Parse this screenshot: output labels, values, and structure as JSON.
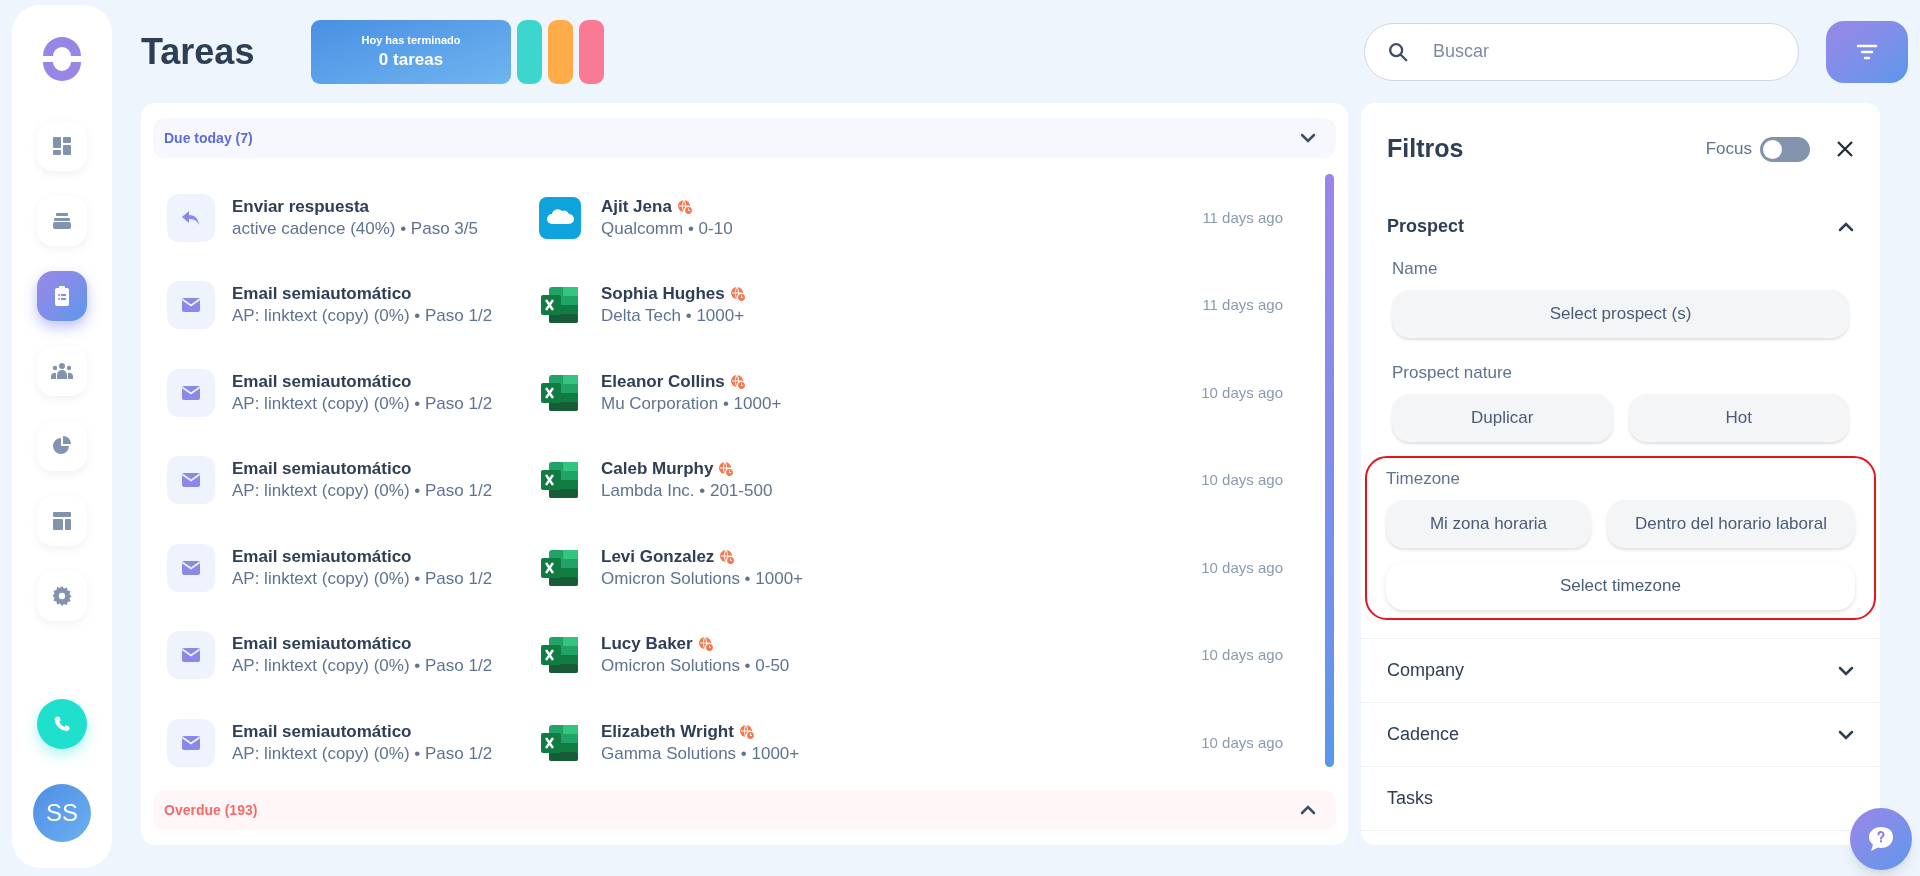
{
  "sidebar": {
    "items": [
      {
        "kind": "dashboard",
        "selected": false
      },
      {
        "kind": "inbox",
        "selected": false
      },
      {
        "kind": "tasks",
        "selected": true
      },
      {
        "kind": "people",
        "selected": false
      },
      {
        "kind": "chart",
        "selected": false
      },
      {
        "kind": "layout",
        "selected": false
      },
      {
        "kind": "settings",
        "selected": false
      }
    ],
    "avatar": "SS"
  },
  "header": {
    "title": "Tareas",
    "stats": {
      "label": "Hoy has terminado",
      "value": "0 tareas"
    },
    "pills": [
      {
        "color": "#3dd6cf"
      },
      {
        "color": "#ffab48"
      },
      {
        "color": "#fa7a93"
      }
    ],
    "search": {
      "placeholder": "Buscar"
    }
  },
  "tasks": {
    "due_today": {
      "label": "Due today (7)",
      "expanded": true
    },
    "rows": [
      {
        "kind": "reply",
        "title": "Enviar respuesta",
        "subtitle": "active cadence (40%) • Paso 3/5",
        "contact": {
          "kind": "salesforce",
          "name": "Ajit Jena",
          "company": "Qualcomm • 0-10"
        },
        "time": "11 days ago"
      },
      {
        "kind": "email",
        "title": "Email semiautomático",
        "subtitle": "AP: linktext (copy) (0%) • Paso 1/2",
        "contact": {
          "kind": "excel",
          "name": "Sophia Hughes",
          "company": "Delta Tech • 1000+"
        },
        "time": "11 days ago"
      },
      {
        "kind": "email",
        "title": "Email semiautomático",
        "subtitle": "AP: linktext (copy) (0%) • Paso 1/2",
        "contact": {
          "kind": "excel",
          "name": "Eleanor Collins",
          "company": "Mu Corporation • 1000+"
        },
        "time": "10 days ago"
      },
      {
        "kind": "email",
        "title": "Email semiautomático",
        "subtitle": "AP: linktext (copy) (0%) • Paso 1/2",
        "contact": {
          "kind": "excel",
          "name": "Caleb Murphy",
          "company": "Lambda Inc. • 201-500"
        },
        "time": "10 days ago"
      },
      {
        "kind": "email",
        "title": "Email semiautomático",
        "subtitle": "AP: linktext (copy) (0%) • Paso 1/2",
        "contact": {
          "kind": "excel",
          "name": "Levi Gonzalez",
          "company": "Omicron Solutions • 1000+"
        },
        "time": "10 days ago"
      },
      {
        "kind": "email",
        "title": "Email semiautomático",
        "subtitle": "AP: linktext (copy) (0%) • Paso 1/2",
        "contact": {
          "kind": "excel",
          "name": "Lucy Baker",
          "company": "Omicron Solutions • 0-50"
        },
        "time": "10 days ago"
      },
      {
        "kind": "email",
        "title": "Email semiautomático",
        "subtitle": "AP: linktext (copy) (0%) • Paso 1/2",
        "contact": {
          "kind": "excel",
          "name": "Elizabeth Wright",
          "company": "Gamma Solutions • 1000+"
        },
        "time": "10 days ago"
      }
    ],
    "overdue": {
      "label": "Overdue (193)",
      "expanded": false
    }
  },
  "filters": {
    "title": "Filtros",
    "focus": {
      "label": "Focus",
      "on": false
    },
    "sections": [
      {
        "title": "Prospect",
        "expanded": true,
        "groups": [
          {
            "label": "Name",
            "highlighted": false,
            "options": [
              {
                "label": "Select prospect (s)",
                "kind": "filled"
              }
            ]
          },
          {
            "label": "Prospect nature",
            "highlighted": false,
            "options": [
              {
                "label": "Duplicar",
                "kind": "filled"
              },
              {
                "label": "Hot",
                "kind": "filled"
              }
            ]
          },
          {
            "label": "Timezone",
            "highlighted": true,
            "options": [
              {
                "label": "Mi zona horaria",
                "kind": "filled"
              },
              {
                "label": "Dentro del horario laboral",
                "kind": "filled"
              },
              {
                "label": "Select timezone",
                "kind": "outline"
              }
            ]
          }
        ]
      },
      {
        "title": "Company",
        "expanded": false
      },
      {
        "title": "Cadence",
        "expanded": false
      },
      {
        "title": "Tasks"
      }
    ]
  }
}
